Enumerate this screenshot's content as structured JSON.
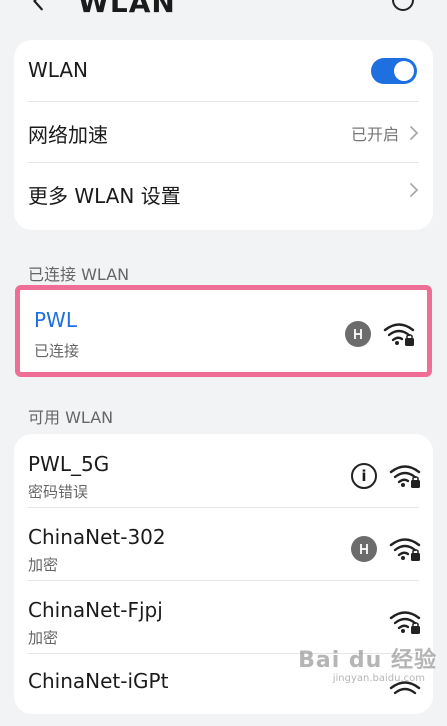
{
  "header": {
    "title": "WLAN"
  },
  "settings": {
    "wlan_label": "WLAN",
    "network_boost_label": "网络加速",
    "network_boost_status": "已开启",
    "more_settings_label": "更多 WLAN 设置"
  },
  "sections": {
    "connected_title": "已连接 WLAN",
    "available_title": "可用 WLAN"
  },
  "connected_network": {
    "name": "PWL",
    "status": "已连接"
  },
  "available_networks": [
    {
      "name": "PWL_5G",
      "status": "密码错误"
    },
    {
      "name": "ChinaNet-302",
      "status": "加密"
    },
    {
      "name": "ChinaNet-Fjpj",
      "status": "加密"
    },
    {
      "name": "ChinaNet-iGPt",
      "status": ""
    }
  ],
  "watermark": {
    "brand": "Bai du 经验",
    "sub": "jingyan.baidu.com"
  },
  "colors": {
    "accent": "#1e6fe0",
    "highlight_border": "#ef6e95"
  }
}
